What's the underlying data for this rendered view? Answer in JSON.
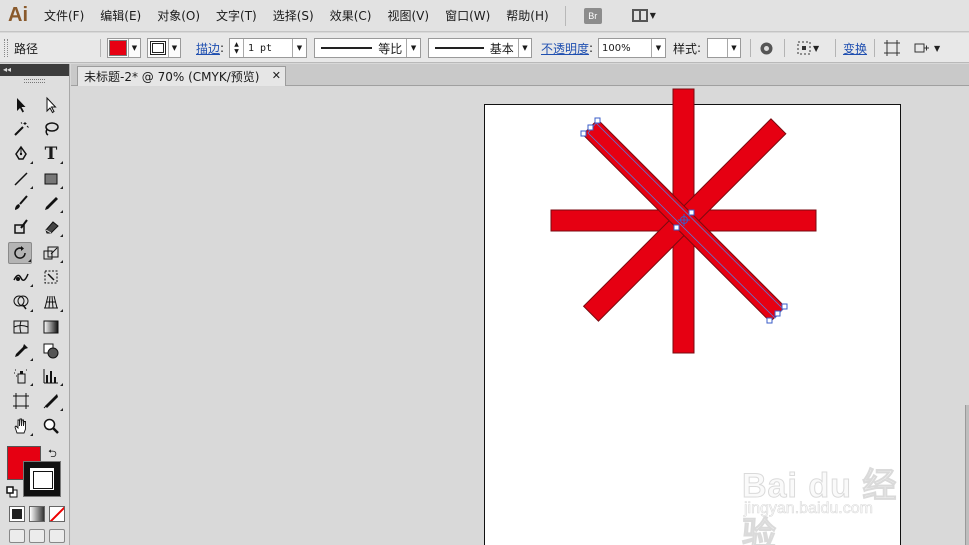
{
  "app": {
    "logo": "Ai",
    "accent": "#8a5a2c"
  },
  "menu": {
    "items": [
      "文件(F)",
      "编辑(E)",
      "对象(O)",
      "文字(T)",
      "选择(S)",
      "效果(C)",
      "视图(V)",
      "窗口(W)",
      "帮助(H)"
    ],
    "bridge_label": "Br",
    "workspace_icon": "workspace-grid-icon"
  },
  "control": {
    "selection_type": "路径",
    "fill_color": "#e60012",
    "stroke_link": "描边",
    "stroke_weight": "1 pt",
    "profile_label": "等比",
    "brush_label": "基本",
    "opacity_link": "不透明度",
    "opacity_value": "100%",
    "style_label": "样式",
    "transform_link": "变换"
  },
  "toolbox": {
    "head_glyph": "◂◂",
    "fill_color": "#e60012",
    "stroke_color": "#111111",
    "tools": [
      "selection",
      "direct-selection",
      "magic-wand",
      "lasso",
      "pen",
      "type",
      "line-segment",
      "rectangle",
      "paintbrush",
      "pencil",
      "blob-brush",
      "eraser",
      "rotate",
      "scale",
      "warp",
      "free-transform",
      "shape-builder",
      "perspective-grid",
      "mesh",
      "gradient",
      "eyedropper",
      "blend",
      "symbol-sprayer",
      "column-graph",
      "artboard",
      "slice",
      "hand",
      "zoom"
    ],
    "active_tool": "rotate"
  },
  "document": {
    "tab_title": "未标题-2* @ 70% (CMYK/预览)",
    "close_glyph": "✕",
    "artwork": {
      "shape": "eight-point asterisk",
      "fill": "#e60012",
      "stroke": "#7a0a10"
    }
  },
  "watermark": {
    "brand": "Bai du 经验",
    "domain": "jingyan.baidu.com"
  }
}
